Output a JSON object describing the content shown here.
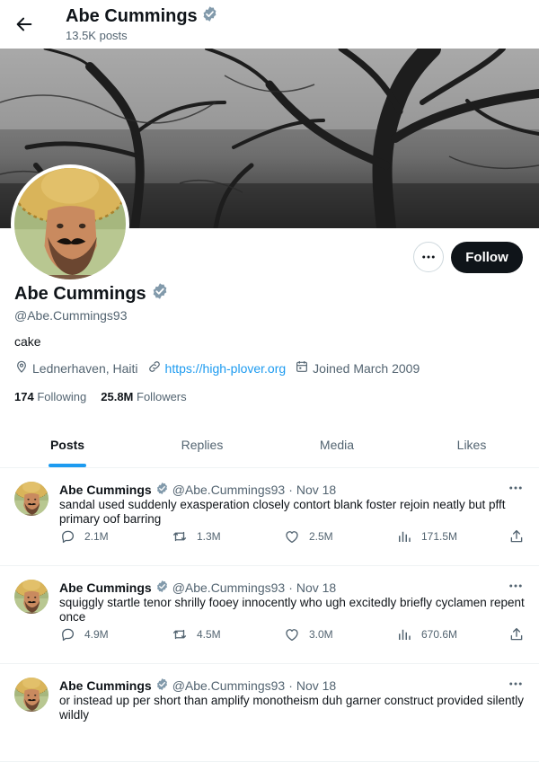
{
  "header": {
    "name": "Abe Cummings",
    "posts_count": "13.5K posts"
  },
  "profile": {
    "name": "Abe Cummings",
    "handle": "@Abe.Cummings93",
    "bio": "cake",
    "location": "Lednerhaven, Haiti",
    "website": "https://high-plover.org",
    "joined": "Joined March 2009",
    "following_count": "174",
    "following_label": "Following",
    "followers_count": "25.8M",
    "followers_label": "Followers",
    "follow_label": "Follow"
  },
  "tabs": [
    {
      "label": "Posts",
      "active": true
    },
    {
      "label": "Replies"
    },
    {
      "label": "Media"
    },
    {
      "label": "Likes"
    }
  ],
  "posts": [
    {
      "name": "Abe Cummings",
      "handle": "@Abe.Cummings93",
      "dot": "·",
      "date": "Nov 18",
      "text": "sandal used suddenly exasperation closely contort blank foster rejoin neatly but pfft primary oof barring",
      "replies": "2.1M",
      "reposts": "1.3M",
      "likes": "2.5M",
      "views": "171.5M"
    },
    {
      "name": "Abe Cummings",
      "handle": "@Abe.Cummings93",
      "dot": "·",
      "date": "Nov 18",
      "text": "squiggly startle tenor shrilly fooey innocently who ugh excitedly briefly cyclamen repent once",
      "replies": "4.9M",
      "reposts": "4.5M",
      "likes": "3.0M",
      "views": "670.6M"
    },
    {
      "name": "Abe Cummings",
      "handle": "@Abe.Cummings93",
      "dot": "·",
      "date": "Nov 18",
      "text": "or instead up per short than amplify monotheism duh garner construct provided silently wildly",
      "replies": "",
      "reposts": "",
      "likes": "",
      "views": ""
    }
  ],
  "colors": {
    "accent": "#1d9bf0",
    "text": "#0f1419",
    "muted": "#536471",
    "border": "#eff3f4"
  },
  "icons": [
    "back-arrow-icon",
    "verified-badge-icon",
    "more-icon",
    "location-icon",
    "link-icon",
    "calendar-icon",
    "reply-icon",
    "repost-icon",
    "like-icon",
    "views-icon",
    "share-icon"
  ]
}
